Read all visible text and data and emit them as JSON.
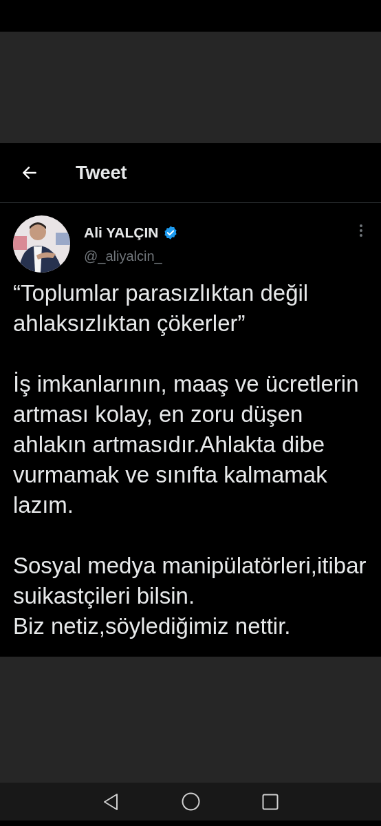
{
  "header": {
    "title": "Tweet"
  },
  "tweet": {
    "author": {
      "name": "Ali YALÇIN",
      "verified": true,
      "handle": "@_aliyalcin_"
    },
    "paragraphs": [
      "“Toplumlar parasızlıktan değil ahlaksızlıktan çökerler”",
      "İş imkanlarının, maaş ve ücretlerin artması kolay, en zoru düşen ahlakın artmasıdır.Ahlakta dibe vurmamak ve sınıfta kalmamak lazım.",
      "Sosyal medya manipülatörleri,itibar suikastçileri bilsin.\nBiz netiz,söylediğimiz nettir."
    ]
  }
}
